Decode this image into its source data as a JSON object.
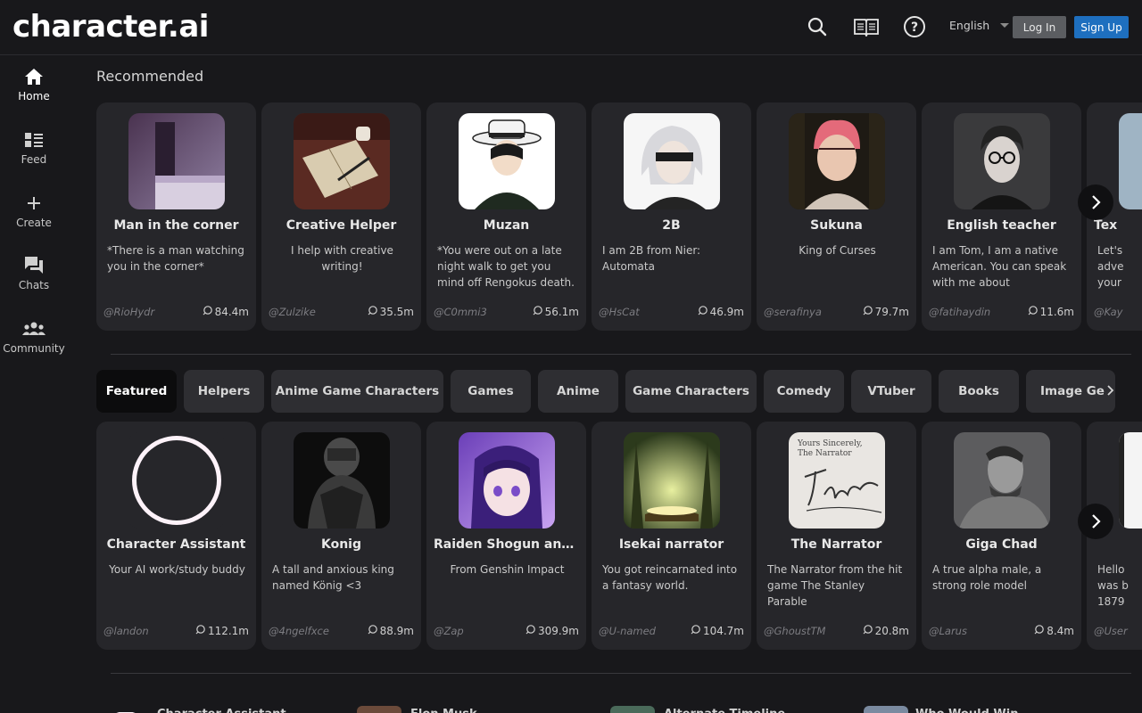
{
  "brand": {
    "logo": "character.ai"
  },
  "header": {
    "language": "English",
    "login_label": "Log In",
    "signup_label": "Sign Up",
    "icons": [
      "search-icon",
      "book-icon",
      "help-icon"
    ]
  },
  "sidebar": {
    "items": [
      {
        "label": "Home",
        "icon": "home-icon",
        "active": true
      },
      {
        "label": "Feed",
        "icon": "feed-icon",
        "active": false
      },
      {
        "label": "Create",
        "icon": "plus-icon",
        "active": false
      },
      {
        "label": "Chats",
        "icon": "chats-icon",
        "active": false
      },
      {
        "label": "Community",
        "icon": "community-icon",
        "active": false
      }
    ]
  },
  "recommended": {
    "title": "Recommended",
    "cards": [
      {
        "name": "Man in the corner",
        "desc": "*There is a man watching you in the corner*",
        "author": "@RioHydr",
        "count": "84.4m"
      },
      {
        "name": "Creative Helper",
        "desc": "I help with creative writing!",
        "author": "@Zulzike",
        "count": "35.5m"
      },
      {
        "name": "Muzan",
        "desc": "*You were out on a late night walk to get you mind off Rengokus death. You,...",
        "author": "@C0mmi3",
        "count": "56.1m"
      },
      {
        "name": "2B",
        "desc": "I am 2B from Nier: Automata",
        "author": "@HsCat",
        "count": "46.9m"
      },
      {
        "name": "Sukuna",
        "desc": "King of Curses",
        "author": "@serafinya",
        "count": "79.7m"
      },
      {
        "name": "English teacher",
        "desc": "I am Tom, I am a native American. You can speak with me about everything...",
        "author": "@fatihaydin",
        "count": "11.6m"
      },
      {
        "name": "Tex",
        "desc": "Let's adve your",
        "author": "@Kay",
        "count": ""
      }
    ]
  },
  "categories": {
    "tabs": [
      "Featured",
      "Helpers",
      "Anime Game Characters",
      "Games",
      "Anime",
      "Game Characters",
      "Comedy",
      "VTuber",
      "Books",
      "Image Ge"
    ],
    "active": "Featured"
  },
  "featured": {
    "cards": [
      {
        "name": "Character Assistant",
        "desc": "Your AI work/study buddy",
        "author": "@landon",
        "count": "112.1m"
      },
      {
        "name": "Konig",
        "desc": "A tall and anxious king named König <3",
        "author": "@4ngelfxce",
        "count": "88.9m"
      },
      {
        "name": "Raiden Shogun and...",
        "desc": "From Genshin Impact",
        "author": "@Zap",
        "count": "309.9m"
      },
      {
        "name": "Isekai narrator",
        "desc": "You got reincarnated into a fantasy world.",
        "author": "@U-named",
        "count": "104.7m"
      },
      {
        "name": "The Narrator",
        "desc": "The Narrator from the hit game The Stanley Parable",
        "author": "@GhoustTM",
        "count": "20.8m"
      },
      {
        "name": "Giga Chad",
        "desc": "A true alpha male, a strong role model",
        "author": "@Larus",
        "count": "8.4m"
      },
      {
        "name": "",
        "desc": "Hello was b 1879",
        "author": "@User",
        "count": ""
      }
    ],
    "narrator_card_text": "Yours Sincerely, The Narrator"
  },
  "bottom_peek": {
    "items": [
      "Character Assistant",
      "Elon Musk",
      "Alternate Timeline",
      "Who Would Win"
    ]
  }
}
